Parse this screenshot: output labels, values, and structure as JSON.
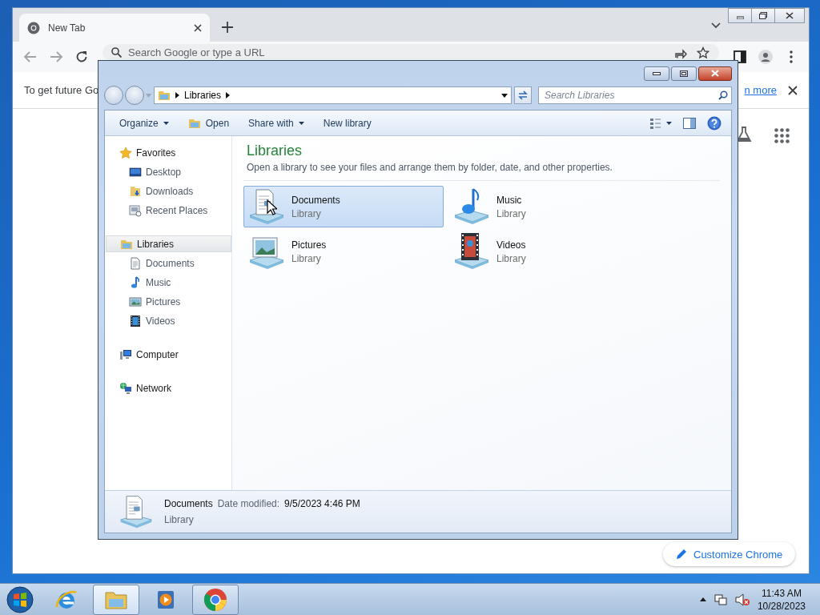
{
  "chrome": {
    "tab": {
      "title": "New Tab"
    },
    "address": {
      "placeholder": "Search Google or type a URL"
    },
    "infobar": {
      "text": "To get future Go",
      "link": "n more"
    },
    "customize_button": "Customize Chrome"
  },
  "explorer": {
    "breadcrumb": [
      "Libraries"
    ],
    "search": {
      "placeholder": "Search Libraries"
    },
    "commands": [
      {
        "label": "Organize",
        "kind": "menu"
      },
      {
        "label": "Open",
        "kind": "icon"
      },
      {
        "label": "Share with",
        "kind": "menu"
      },
      {
        "label": "New library",
        "kind": "plain"
      }
    ],
    "nav": [
      {
        "label": "Favorites",
        "kind": "star",
        "selected": false,
        "children": [
          {
            "label": "Desktop",
            "kind": "desktop",
            "selected": false
          },
          {
            "label": "Downloads",
            "kind": "downloads",
            "selected": false
          },
          {
            "label": "Recent Places",
            "kind": "recent",
            "selected": false
          }
        ]
      },
      {
        "label": "Libraries",
        "kind": "library",
        "selected": true,
        "children": [
          {
            "label": "Documents",
            "kind": "document",
            "selected": false
          },
          {
            "label": "Music",
            "kind": "music",
            "selected": false
          },
          {
            "label": "Pictures",
            "kind": "picture",
            "selected": false
          },
          {
            "label": "Videos",
            "kind": "video",
            "selected": false
          }
        ]
      },
      {
        "label": "Computer",
        "kind": "computer",
        "selected": false
      },
      {
        "label": "Network",
        "kind": "network",
        "selected": false
      }
    ],
    "heading": "Libraries",
    "subtitle": "Open a library to see your files and arrange them by folder, date, and other properties.",
    "libraries": [
      {
        "name": "Documents",
        "type": "Library",
        "kind": "document",
        "selected": true
      },
      {
        "name": "Music",
        "type": "Library",
        "kind": "music",
        "selected": false
      },
      {
        "name": "Pictures",
        "type": "Library",
        "kind": "picture",
        "selected": false
      },
      {
        "name": "Videos",
        "type": "Library",
        "kind": "video",
        "selected": false
      }
    ],
    "details": {
      "name": "Documents",
      "field": "Date modified:",
      "value": "9/5/2023 4:46 PM",
      "type": "Library",
      "kind": "document"
    }
  },
  "taskbar": {
    "items": [
      {
        "kind": "ie",
        "running": false,
        "selected": false
      },
      {
        "kind": "folder",
        "running": true,
        "selected": true
      },
      {
        "kind": "media",
        "running": false,
        "selected": false
      },
      {
        "kind": "chrome",
        "running": true,
        "selected": false
      }
    ],
    "clock": {
      "time": "11:43 AM",
      "date": "10/28/2023"
    }
  }
}
